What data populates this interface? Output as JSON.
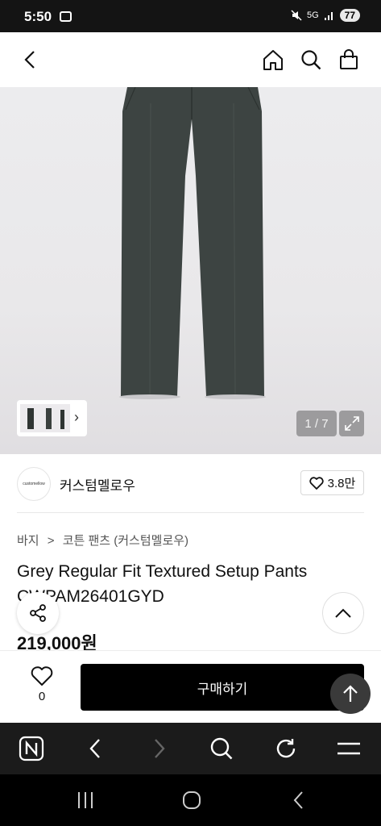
{
  "status_bar": {
    "time": "5:50",
    "network": "5G",
    "battery": "77"
  },
  "header": {
    "back_icon": "chevron-left-icon",
    "home_icon": "home-icon",
    "search_icon": "search-icon",
    "bag_icon": "shopping-bag-icon"
  },
  "gallery": {
    "counter": "1 / 7",
    "thumb_arrow": "›"
  },
  "brand": {
    "logo_text": "customellow",
    "name": "커스텀멜로우",
    "likes": "3.8만"
  },
  "breadcrumb": {
    "category": "바지",
    "separator": ">",
    "subcategory": "코튼 팬츠 (커스텀멜로우)"
  },
  "product": {
    "title": "Grey Regular Fit Textured Setup Pants CWPAM26401GYD",
    "price": "219,000원"
  },
  "bottom_bar": {
    "wish_count": "0",
    "buy_label": "구매하기"
  },
  "colors": {
    "accent": "#000000",
    "image_bg": "#e9e8ea",
    "pants": "#3d4442"
  }
}
